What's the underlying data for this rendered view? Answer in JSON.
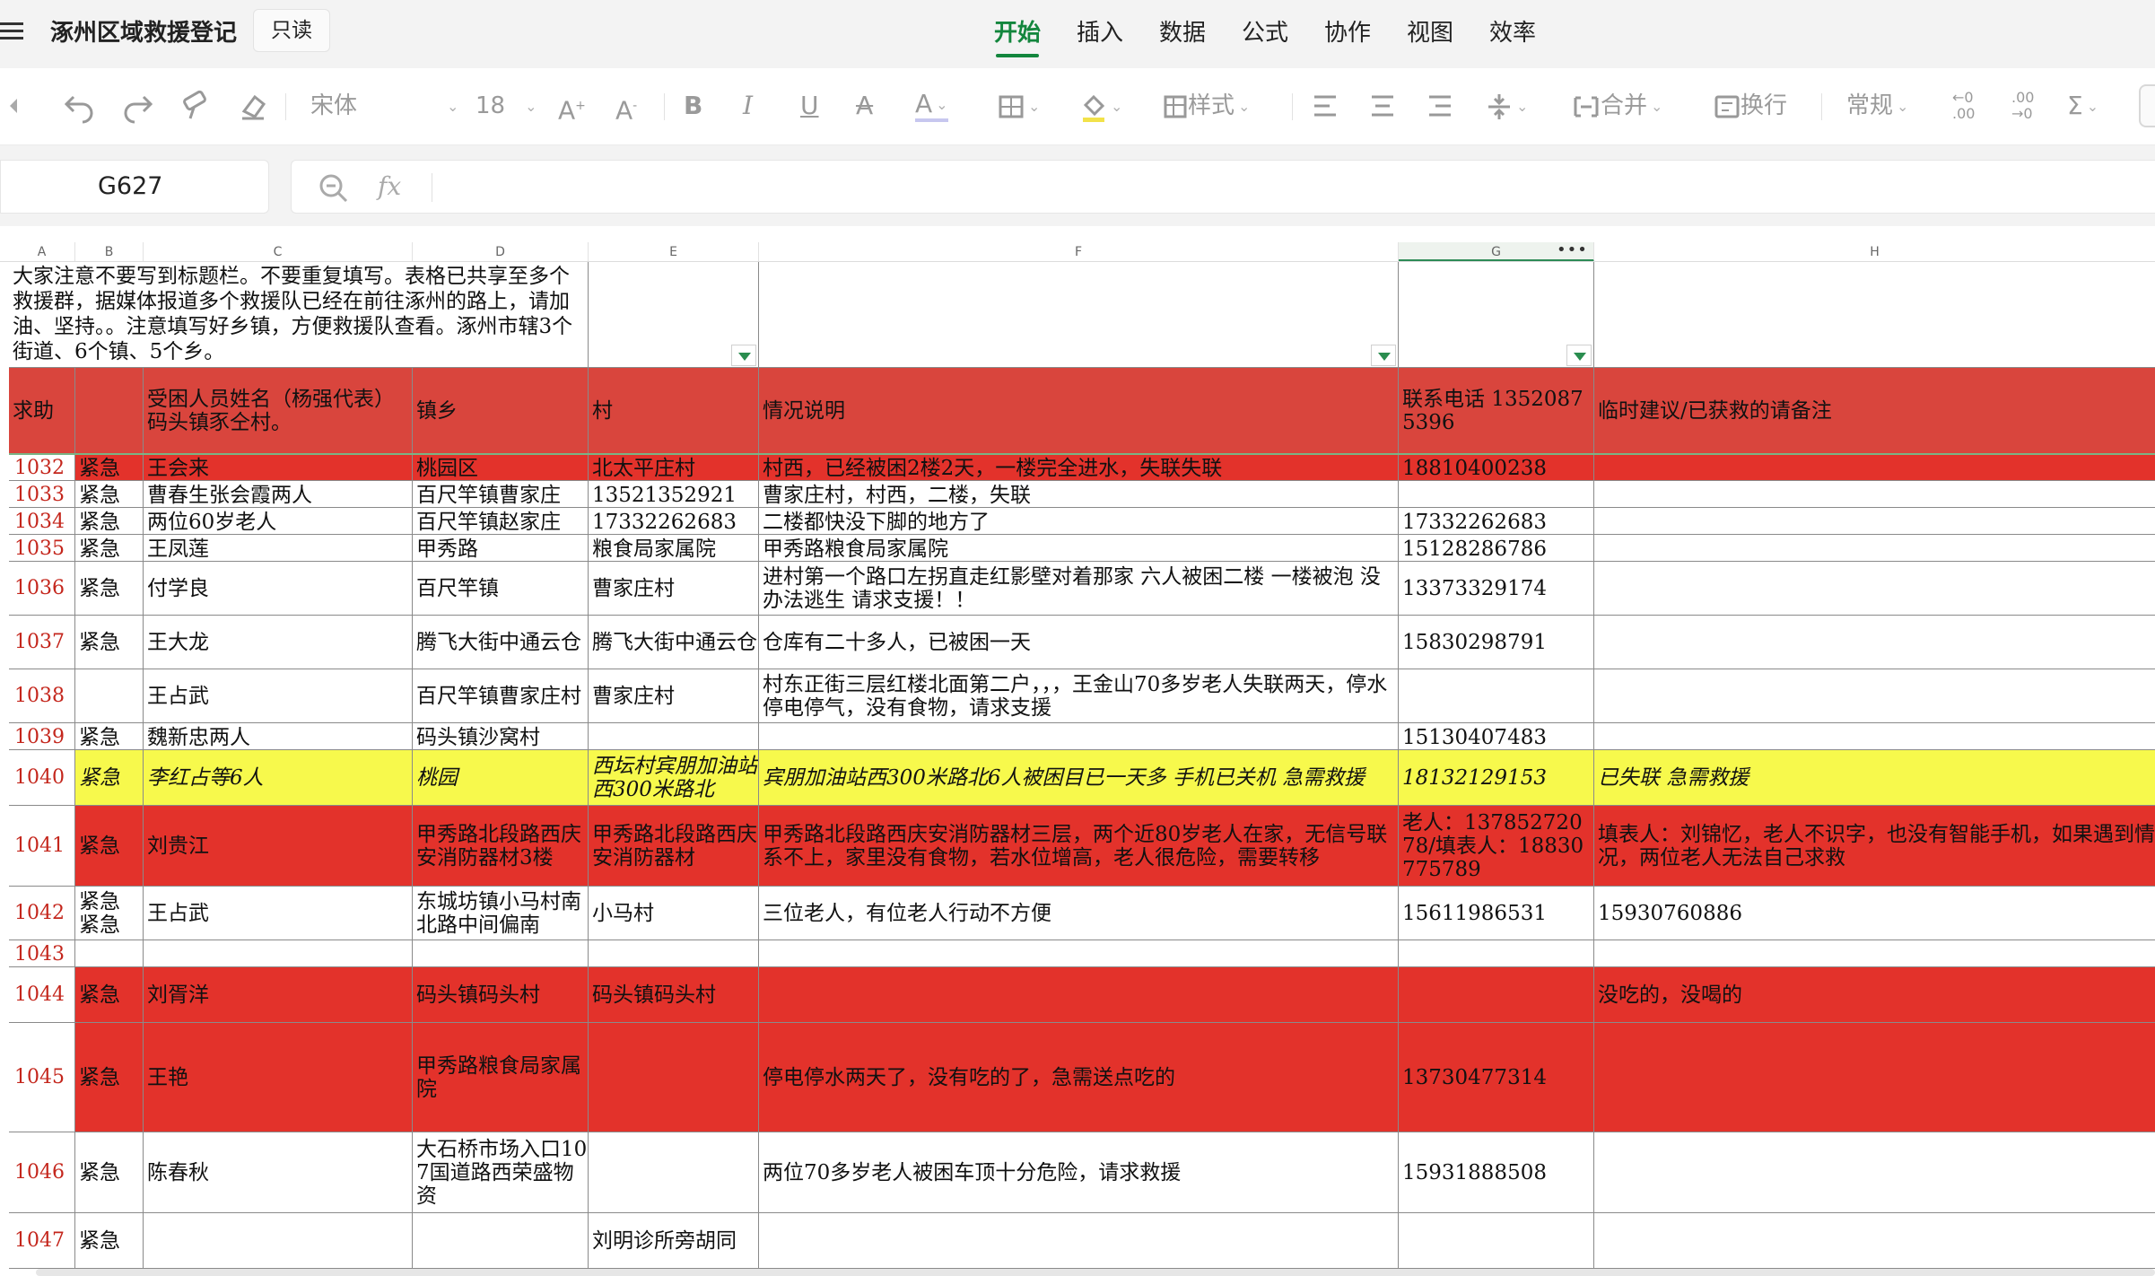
{
  "app": {
    "title": "涿州区域救援登记",
    "readonly_badge": "只读",
    "tabs": [
      "开始",
      "插入",
      "数据",
      "公式",
      "协作",
      "视图",
      "效率"
    ],
    "active_tab": "开始"
  },
  "toolbar": {
    "font_name": "宋体",
    "font_size": "18",
    "style_label": "样式",
    "merge_label": "合并",
    "wrap_label": "换行",
    "number_format": "常规"
  },
  "formula_bar": {
    "name_box": "G627",
    "fx_label": "fx",
    "content": ""
  },
  "columns": [
    "A",
    "B",
    "C",
    "D",
    "E",
    "F",
    "G",
    "H"
  ],
  "selected_column": "G",
  "sheet": {
    "note": "大家注意不要写到标题栏。不要重复填写。表格已共享至多个救援群，据媒体报道多个救援队已经在前往涿州的路上，请加油、坚持。。注意填写好乡镇，方便救援队查看。涿州市辖3个街道、6个镇、5个乡。",
    "header": {
      "a": "求助",
      "b": "",
      "c": "受困人员姓名（杨强代表）码头镇豕仝村。",
      "d": "镇乡",
      "e": "村",
      "f": "情况说明",
      "g": "联系电话 13520875396",
      "h": "临时建议/已获救的请备注"
    },
    "rows": [
      {
        "no": "1032",
        "b": "紧急",
        "c": "王会来",
        "d": "桃园区",
        "e": "北太平庄村",
        "f": "村西，已经被困2楼2天，一楼完全进水，失联失联",
        "g": "18810400238",
        "h": ""
      },
      {
        "no": "1033",
        "b": "紧急",
        "c": "曹春生张会霞两人",
        "d": "百尺竿镇曹家庄",
        "e": "13521352921",
        "f": "曹家庄村，村西，二楼，失联",
        "g": "",
        "h": ""
      },
      {
        "no": "1034",
        "b": "紧急",
        "c": "两位60岁老人",
        "d": "百尺竿镇赵家庄",
        "e": "17332262683",
        "f": "二楼都快没下脚的地方了",
        "g": "17332262683",
        "h": ""
      },
      {
        "no": "1035",
        "b": "紧急",
        "c": "王凤莲",
        "d": "甲秀路",
        "e": "粮食局家属院",
        "f": "甲秀路粮食局家属院",
        "g": "15128286786",
        "h": ""
      },
      {
        "no": "1036",
        "b": "紧急",
        "c": "付学良",
        "d": "百尺竿镇",
        "e": "曹家庄村",
        "f": "进村第一个路口左拐直走红影壁对着那家 六人被困二楼 一楼被泡 没办法逃生 请求支援！！",
        "g": "13373329174",
        "h": ""
      },
      {
        "no": "1037",
        "b": "紧急",
        "c": "王大龙",
        "d": "腾飞大街中通云仓",
        "e": "腾飞大街中通云仓",
        "f": "仓库有二十多人，已被困一天",
        "g": "15830298791",
        "h": ""
      },
      {
        "no": "1038",
        "b": "",
        "c": "王占武",
        "d": "百尺竿镇曹家庄村",
        "e": "曹家庄村",
        "f": "村东正街三层红楼北面第二户，，，王金山70多岁老人失联两天，停水停电停气，没有食物，请求支援",
        "g": "",
        "h": ""
      },
      {
        "no": "1039",
        "b": "紧急",
        "c": "魏新忠两人",
        "d": "码头镇沙窝村",
        "e": "",
        "f": "",
        "g": "15130407483",
        "h": ""
      },
      {
        "no": "1040",
        "b": "紧急",
        "c": "李红占等6人",
        "d": "桃园",
        "e": "西坛村宾朋加油站西300米路北",
        "f": "宾朋加油站西300米路北6人被困目已一天多  手机已关机  急需救援",
        "g": "18132129153",
        "h": "已失联  急需救援"
      },
      {
        "no": "1041",
        "b": "紧急",
        "c": "刘贵江",
        "d": "甲秀路北段路西庆安消防器材3楼",
        "e": "甲秀路北段路西庆安消防器材",
        "f": "甲秀路北段路西庆安消防器材三层，两个近80岁老人在家，无信号联系不上，家里没有食物，若水位增高，老人很危险，需要转移",
        "g": "老人：13785272078/填表人：18830775789",
        "h": "填表人：刘锦忆，老人不识字，也没有智能手机，如果遇到情况，两位老人无法自己求救"
      },
      {
        "no": "1042",
        "b": "紧急\n紧急",
        "c": "王占武",
        "d": "东城坊镇小马村南北路中间偏南",
        "e": "小马村",
        "f": "三位老人，有位老人行动不方便",
        "g": "15611986531",
        "h": "15930760886"
      },
      {
        "no": "1043",
        "b": "",
        "c": "",
        "d": "",
        "e": "",
        "f": "",
        "g": "",
        "h": ""
      },
      {
        "no": "1044",
        "b": "紧急",
        "c": "刘胥洋",
        "d": "码头镇码头村",
        "e": "码头镇码头村",
        "f": "",
        "g": "",
        "h": "没吃的，没喝的"
      },
      {
        "no": "1045",
        "b": "紧急",
        "c": "王艳",
        "d": "甲秀路粮食局家属院",
        "e": "",
        "f": "停电停水两天了，没有吃的了，急需送点吃的",
        "g": "13730477314",
        "h": ""
      },
      {
        "no": "1046",
        "b": "紧急",
        "c": "陈春秋",
        "d": "大石桥市场入口107国道路西荣盛物资",
        "e": "",
        "f": "两位70多岁老人被困车顶十分危险，请求救援",
        "g": "15931888508",
        "h": ""
      },
      {
        "no": "1047",
        "b": "紧急",
        "c": "",
        "d": "",
        "e": "刘明诊所旁胡同",
        "f": "",
        "g": "",
        "h": ""
      }
    ]
  },
  "colors": {
    "accent_green": "#13863d",
    "urgent_red": "#e3322b",
    "header_red": "#d9453d",
    "highlight_yellow": "#f7f94c",
    "row_number_red": "#c4261c"
  }
}
